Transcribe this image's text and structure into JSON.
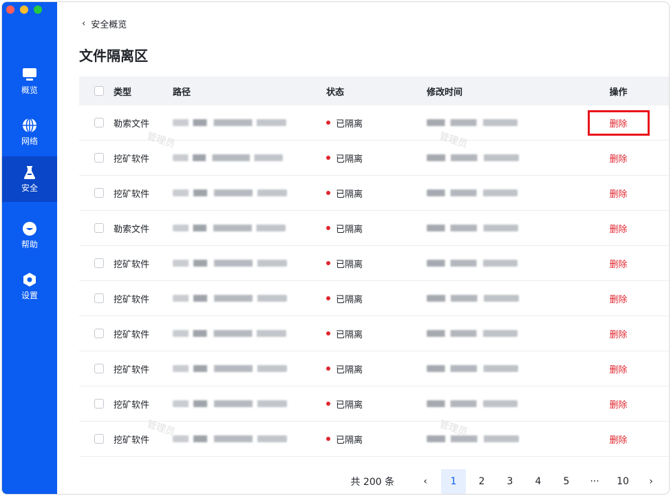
{
  "sidebar": {
    "items": [
      {
        "label": "概览",
        "icon": "monitor-icon"
      },
      {
        "label": "网络",
        "icon": "globe-icon"
      },
      {
        "label": "安全",
        "icon": "flask-icon"
      },
      {
        "label": "帮助",
        "icon": "help-icon"
      },
      {
        "label": "设置",
        "icon": "hexagon-settings-icon"
      }
    ],
    "active_index": 2,
    "color": "#0b5cf0"
  },
  "breadcrumb": {
    "back_label": "安全概览"
  },
  "page": {
    "title": "文件隔离区"
  },
  "table": {
    "headers": {
      "type": "类型",
      "path": "路径",
      "status": "状态",
      "modified": "修改时间",
      "action": "操作"
    },
    "rows": [
      {
        "type": "勒索文件",
        "status": "已隔离",
        "action": "删除"
      },
      {
        "type": "挖矿软件",
        "status": "已隔离",
        "action": "删除"
      },
      {
        "type": "挖矿软件",
        "status": "已隔离",
        "action": "删除"
      },
      {
        "type": "勒索文件",
        "status": "已隔离",
        "action": "删除"
      },
      {
        "type": "挖矿软件",
        "status": "已隔离",
        "action": "删除"
      },
      {
        "type": "挖矿软件",
        "status": "已隔离",
        "action": "删除"
      },
      {
        "type": "挖矿软件",
        "status": "已隔离",
        "action": "删除"
      },
      {
        "type": "挖矿软件",
        "status": "已隔离",
        "action": "删除"
      },
      {
        "type": "挖矿软件",
        "status": "已隔离",
        "action": "删除"
      },
      {
        "type": "挖矿软件",
        "status": "已隔离",
        "action": "删除"
      }
    ]
  },
  "pagination": {
    "total": "共 200 条",
    "prev": "‹",
    "next": "›",
    "pages": [
      "1",
      "2",
      "3",
      "4",
      "5",
      "···",
      "10"
    ],
    "current": "1"
  },
  "watermark": "管理员",
  "colors": {
    "danger": "#e0262f",
    "accent": "#0b5cf0"
  }
}
